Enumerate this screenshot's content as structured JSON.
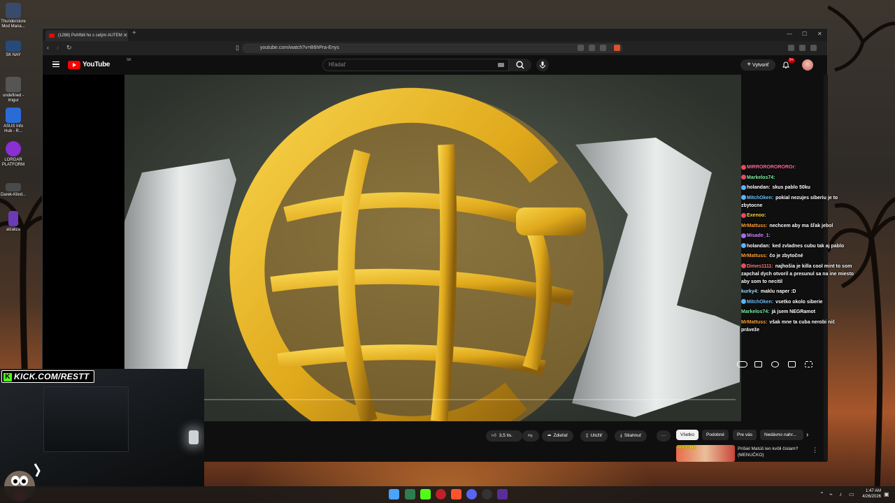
{
  "desktop": {
    "icons": [
      {
        "label": "Thunderstore Mod Mana...",
        "color": "#3a4a6a"
      },
      {
        "label": "SK NAY",
        "color": "#274a7a"
      },
      {
        "label": "undefined - Imgur",
        "color": "#555"
      },
      {
        "label": "ASUS Info Hub - R...",
        "color": "#2a6bd8"
      },
      {
        "label": "LORGAR PLATFORM",
        "color": "#8a2fd1"
      },
      {
        "label": "Darek-Kilvd...",
        "color": "#4a4a4a"
      },
      {
        "label": "alzaliza",
        "color": "#6a3ab8"
      }
    ]
  },
  "browser": {
    "tab_title": "(1288) Pohřbili ho s celým AUTEM",
    "url": "youtube.com/watch?v=B6hPra-Enys"
  },
  "youtube": {
    "logo_text": "YouTube",
    "region": "SK",
    "search_placeholder": "Hľadať",
    "create_label": "Vytvoriť",
    "notifications": "9+"
  },
  "actions": {
    "likes": "3,5 tis.",
    "share": "Zdieľať",
    "save": "Uložiť",
    "download": "Stiahnuť",
    "more": "···"
  },
  "chips": [
    "Všetko",
    "Podobné",
    "Pre vás",
    "Nedávno nahr..."
  ],
  "recommended": {
    "badge": "NOVÝ DÍEL",
    "title": "Prišiel Matúš len kvôli čislam?",
    "subtitle": "(MENUČKO)"
  },
  "chat": [
    {
      "user": "MIRROROROROROr:",
      "color": "#ff6b9a",
      "text": "",
      "emote": "#e84a5f"
    },
    {
      "user": "Markelos74:",
      "color": "#7cf0a5",
      "text": "",
      "emote": "#e84a5f"
    },
    {
      "user": "holandan:",
      "color": "#ffffff",
      "text": "skus pablo 50ku",
      "emote": "#5ab4ff"
    },
    {
      "user": "MitchOken:",
      "color": "#6fc2ff",
      "text": "pokial nezujes siberiu je to zbytocne",
      "emote": "#5ab4ff"
    },
    {
      "user": "Exenoo:",
      "color": "#ffd24a",
      "text": "",
      "emote": "#e84a5f"
    },
    {
      "user": "MrMattuss:",
      "color": "#ffa23a",
      "text": "nechcem aby ma šľak jebol",
      "emote": ""
    },
    {
      "user": "Misade_1:",
      "color": "#d08bff",
      "text": "",
      "emote": "#a06bff"
    },
    {
      "user": "holandan:",
      "color": "#ffffff",
      "text": "ked zvladnes cubu tak aj pablo",
      "emote": "#5ab4ff"
    },
    {
      "user": "MrMattuss:",
      "color": "#ffa23a",
      "text": "čo je zbytočné",
      "emote": ""
    },
    {
      "user": "Dimes1111:",
      "color": "#ff7d7d",
      "text": "najhošia je killa cool mint to som zapchal dych otvoril a presunul sa na ine miesto aby som to necitil",
      "emote": "#e84a5f"
    },
    {
      "user": "kurky4:",
      "color": "#9fe0ff",
      "text": "maklu naper :D",
      "emote": ""
    },
    {
      "user": "MitchOken:",
      "color": "#6fc2ff",
      "text": "vsetko okolo siberie",
      "emote": "#5ab4ff"
    },
    {
      "user": "Markelos74:",
      "color": "#7cf0a5",
      "text": "já jsem NEGRamot",
      "emote": ""
    },
    {
      "user": "MrMattuss:",
      "color": "#ffa23a",
      "text": "však mne ta cuba nerobi nič práveže",
      "emote": ""
    }
  ],
  "stream": {
    "kick_label": "KICK.COM/RESTT"
  },
  "taskbar": {
    "time": "1:47 AM",
    "date": "4/26/2026"
  }
}
